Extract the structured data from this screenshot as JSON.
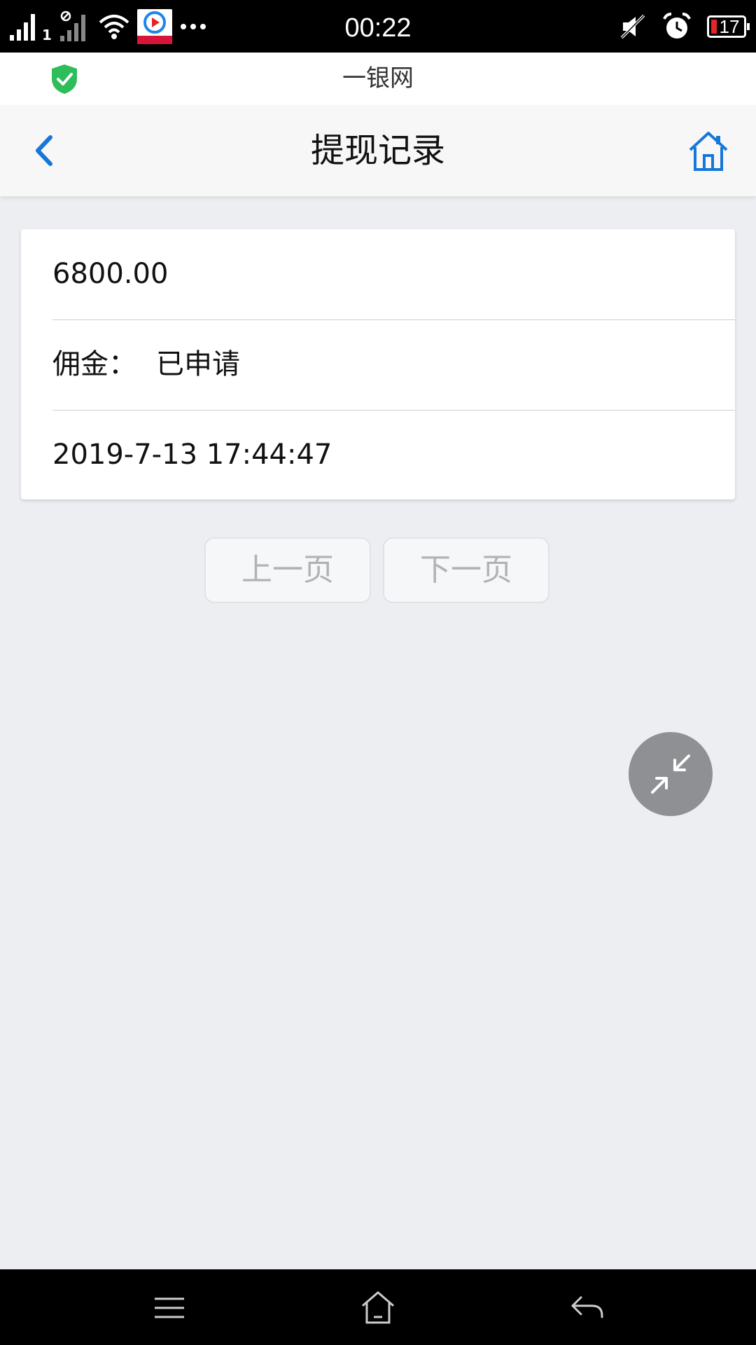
{
  "status_bar": {
    "time": "00:22",
    "sim_label": "1",
    "battery_level": "17",
    "left_icons": [
      "signal-icon",
      "no-sim-signal-icon",
      "wifi-icon",
      "app-notification-icon",
      "more-dots-icon"
    ],
    "right_icons": [
      "mute-icon",
      "alarm-icon",
      "battery-icon"
    ]
  },
  "browser": {
    "title": "一银网",
    "secure_icon": "shield-check-icon",
    "accent": "#2ebd5a"
  },
  "nav": {
    "title": "提现记录",
    "back_icon": "chevron-left-icon",
    "home_icon": "home-icon",
    "accent": "#1677d8"
  },
  "record": {
    "amount": "6800.00",
    "type_label": "佣金：",
    "status": "已申请",
    "datetime": "2019-7-13 17:44:47"
  },
  "pagination": {
    "prev_label": "上一页",
    "next_label": "下一页"
  },
  "float_button": {
    "icon": "collapse-arrows-icon"
  },
  "system_nav": {
    "menu_icon": "menu-icon",
    "home_icon": "home-outline-icon",
    "back_icon": "back-arrow-icon"
  }
}
